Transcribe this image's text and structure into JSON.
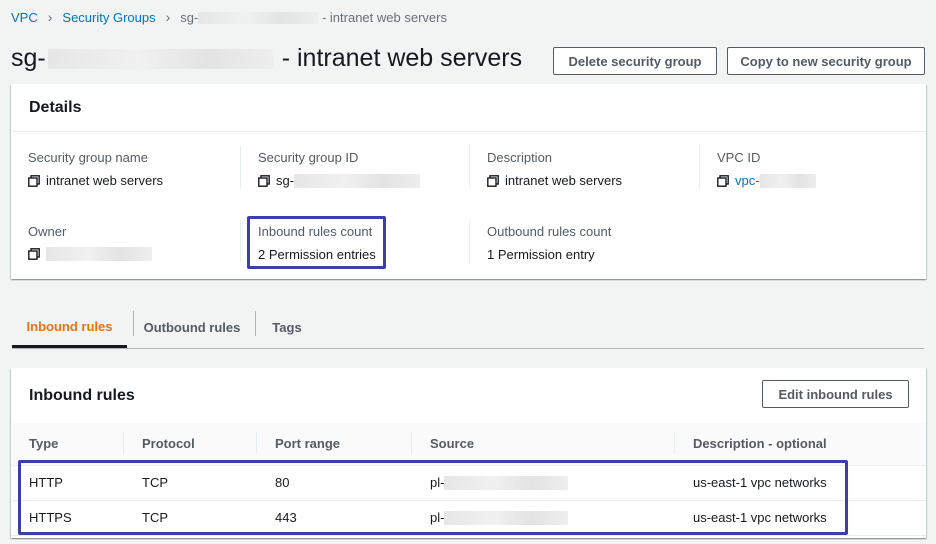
{
  "breadcrumb": {
    "items": [
      "VPC",
      "Security Groups"
    ],
    "current_prefix": "sg-",
    "current_suffix": "- intranet web servers"
  },
  "header": {
    "title_prefix": "sg-",
    "title_suffix": "- intranet web servers",
    "delete_button": "Delete security group",
    "copy_button": "Copy to new security group"
  },
  "details": {
    "title": "Details",
    "security_group_name_label": "Security group name",
    "security_group_name": "intranet web servers",
    "security_group_id_label": "Security group ID",
    "security_group_id_prefix": "sg-",
    "description_label": "Description",
    "description": "intranet web servers",
    "vpc_id_label": "VPC ID",
    "vpc_id_prefix": "vpc-",
    "owner_label": "Owner",
    "inbound_count_label": "Inbound rules count",
    "inbound_count": "2 Permission entries",
    "outbound_count_label": "Outbound rules count",
    "outbound_count": "1 Permission entry"
  },
  "tabs": [
    {
      "label": "Inbound rules",
      "active": true
    },
    {
      "label": "Outbound rules",
      "active": false
    },
    {
      "label": "Tags",
      "active": false
    }
  ],
  "inbound": {
    "title": "Inbound rules",
    "edit_button": "Edit inbound rules",
    "columns": [
      "Type",
      "Protocol",
      "Port range",
      "Source",
      "Description - optional"
    ],
    "rows": [
      {
        "type": "HTTP",
        "protocol": "TCP",
        "port": "80",
        "source_prefix": "pl-",
        "description": "us-east-1 vpc networks"
      },
      {
        "type": "HTTPS",
        "protocol": "TCP",
        "port": "443",
        "source_prefix": "pl-",
        "description": "us-east-1 vpc networks"
      }
    ]
  },
  "colors": {
    "link": "#0073bb",
    "active_tab": "#ec7211",
    "highlight": "#3b3fa8"
  }
}
